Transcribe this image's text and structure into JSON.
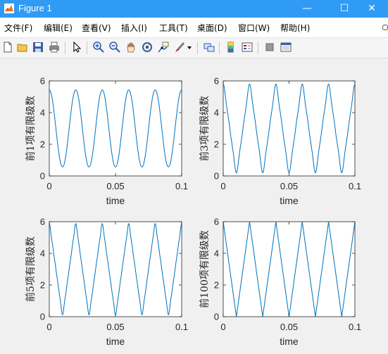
{
  "window": {
    "title": "Figure 1",
    "controls": {
      "minimize": "—",
      "maximize": "☐",
      "close": "✕"
    }
  },
  "menu": [
    "文件(F)",
    "编辑(E)",
    "查看(V)",
    "插入(I)",
    "工具(T)",
    "桌面(D)",
    "窗口(W)",
    "帮助(H)"
  ],
  "toolbar_icons": [
    "new-figure-icon",
    "open-icon",
    "save-icon",
    "print-icon",
    "pointer-icon",
    "zoom-in-icon",
    "zoom-out-icon",
    "pan-icon",
    "rotate-3d-icon",
    "data-cursor-icon",
    "brush-icon",
    "brush-menu-icon",
    "link-plot-icon",
    "colorbar-icon",
    "legend-icon",
    "hide-plot-tools-icon",
    "show-plot-tools-icon"
  ],
  "colors": {
    "line": "#0072bd",
    "titlebar": "#2f9bf5",
    "axes_bg": "#ffffff"
  },
  "chart_data": [
    {
      "type": "line",
      "ylabel": "前1项有限级数",
      "xlabel": "time",
      "xlim": [
        0,
        0.1
      ],
      "ylim": [
        0,
        6
      ],
      "xticks": [
        "0",
        "0.05",
        "0.1"
      ],
      "yticks": [
        "0",
        "2",
        "4",
        "6"
      ],
      "terms": 1,
      "frequency": 50,
      "series": [
        {
          "x": [
            0,
            0.01,
            0.02,
            0.03,
            0.04,
            0.05,
            0.06,
            0.07,
            0.08,
            0.09,
            0.1
          ],
          "y": [
            5.4,
            0.6,
            5.4,
            0.6,
            5.4,
            0.6,
            5.4,
            0.6,
            5.4,
            0.6,
            5.4
          ]
        }
      ]
    },
    {
      "type": "line",
      "ylabel": "前3项有限级数",
      "xlabel": "time",
      "xlim": [
        0,
        0.1
      ],
      "ylim": [
        0,
        6
      ],
      "xticks": [
        "0",
        "0.05",
        "0.1"
      ],
      "yticks": [
        "0",
        "2",
        "4",
        "6"
      ],
      "terms": 3,
      "frequency": 50,
      "series": [
        {
          "x": [
            0,
            0.01,
            0.02,
            0.03,
            0.04,
            0.05,
            0.06,
            0.07,
            0.08,
            0.09,
            0.1
          ],
          "y": [
            5.8,
            0.2,
            5.8,
            0.2,
            5.8,
            0.2,
            5.8,
            0.2,
            5.8,
            0.2,
            5.8
          ]
        }
      ]
    },
    {
      "type": "line",
      "ylabel": "前5项有限级数",
      "xlabel": "time",
      "xlim": [
        0,
        0.1
      ],
      "ylim": [
        0,
        6
      ],
      "xticks": [
        "0",
        "0.05",
        "0.1"
      ],
      "yticks": [
        "0",
        "2",
        "4",
        "6"
      ],
      "terms": 5,
      "frequency": 50,
      "series": [
        {
          "x": [
            0,
            0.01,
            0.02,
            0.03,
            0.04,
            0.05,
            0.06,
            0.07,
            0.08,
            0.09,
            0.1
          ],
          "y": [
            5.9,
            0.1,
            5.9,
            0.1,
            5.9,
            0.1,
            5.9,
            0.1,
            5.9,
            0.1,
            5.9
          ]
        }
      ]
    },
    {
      "type": "line",
      "ylabel": "前100项有限级数",
      "xlabel": "time",
      "xlim": [
        0,
        0.1
      ],
      "ylim": [
        0,
        6
      ],
      "xticks": [
        "0",
        "0.05",
        "0.1"
      ],
      "yticks": [
        "0",
        "2",
        "4",
        "6"
      ],
      "terms": 100,
      "frequency": 50,
      "series": [
        {
          "x": [
            0,
            0.01,
            0.02,
            0.03,
            0.04,
            0.05,
            0.06,
            0.07,
            0.08,
            0.09,
            0.1
          ],
          "y": [
            6,
            0,
            6,
            0,
            6,
            0,
            6,
            0,
            6,
            0,
            6
          ]
        }
      ]
    }
  ]
}
